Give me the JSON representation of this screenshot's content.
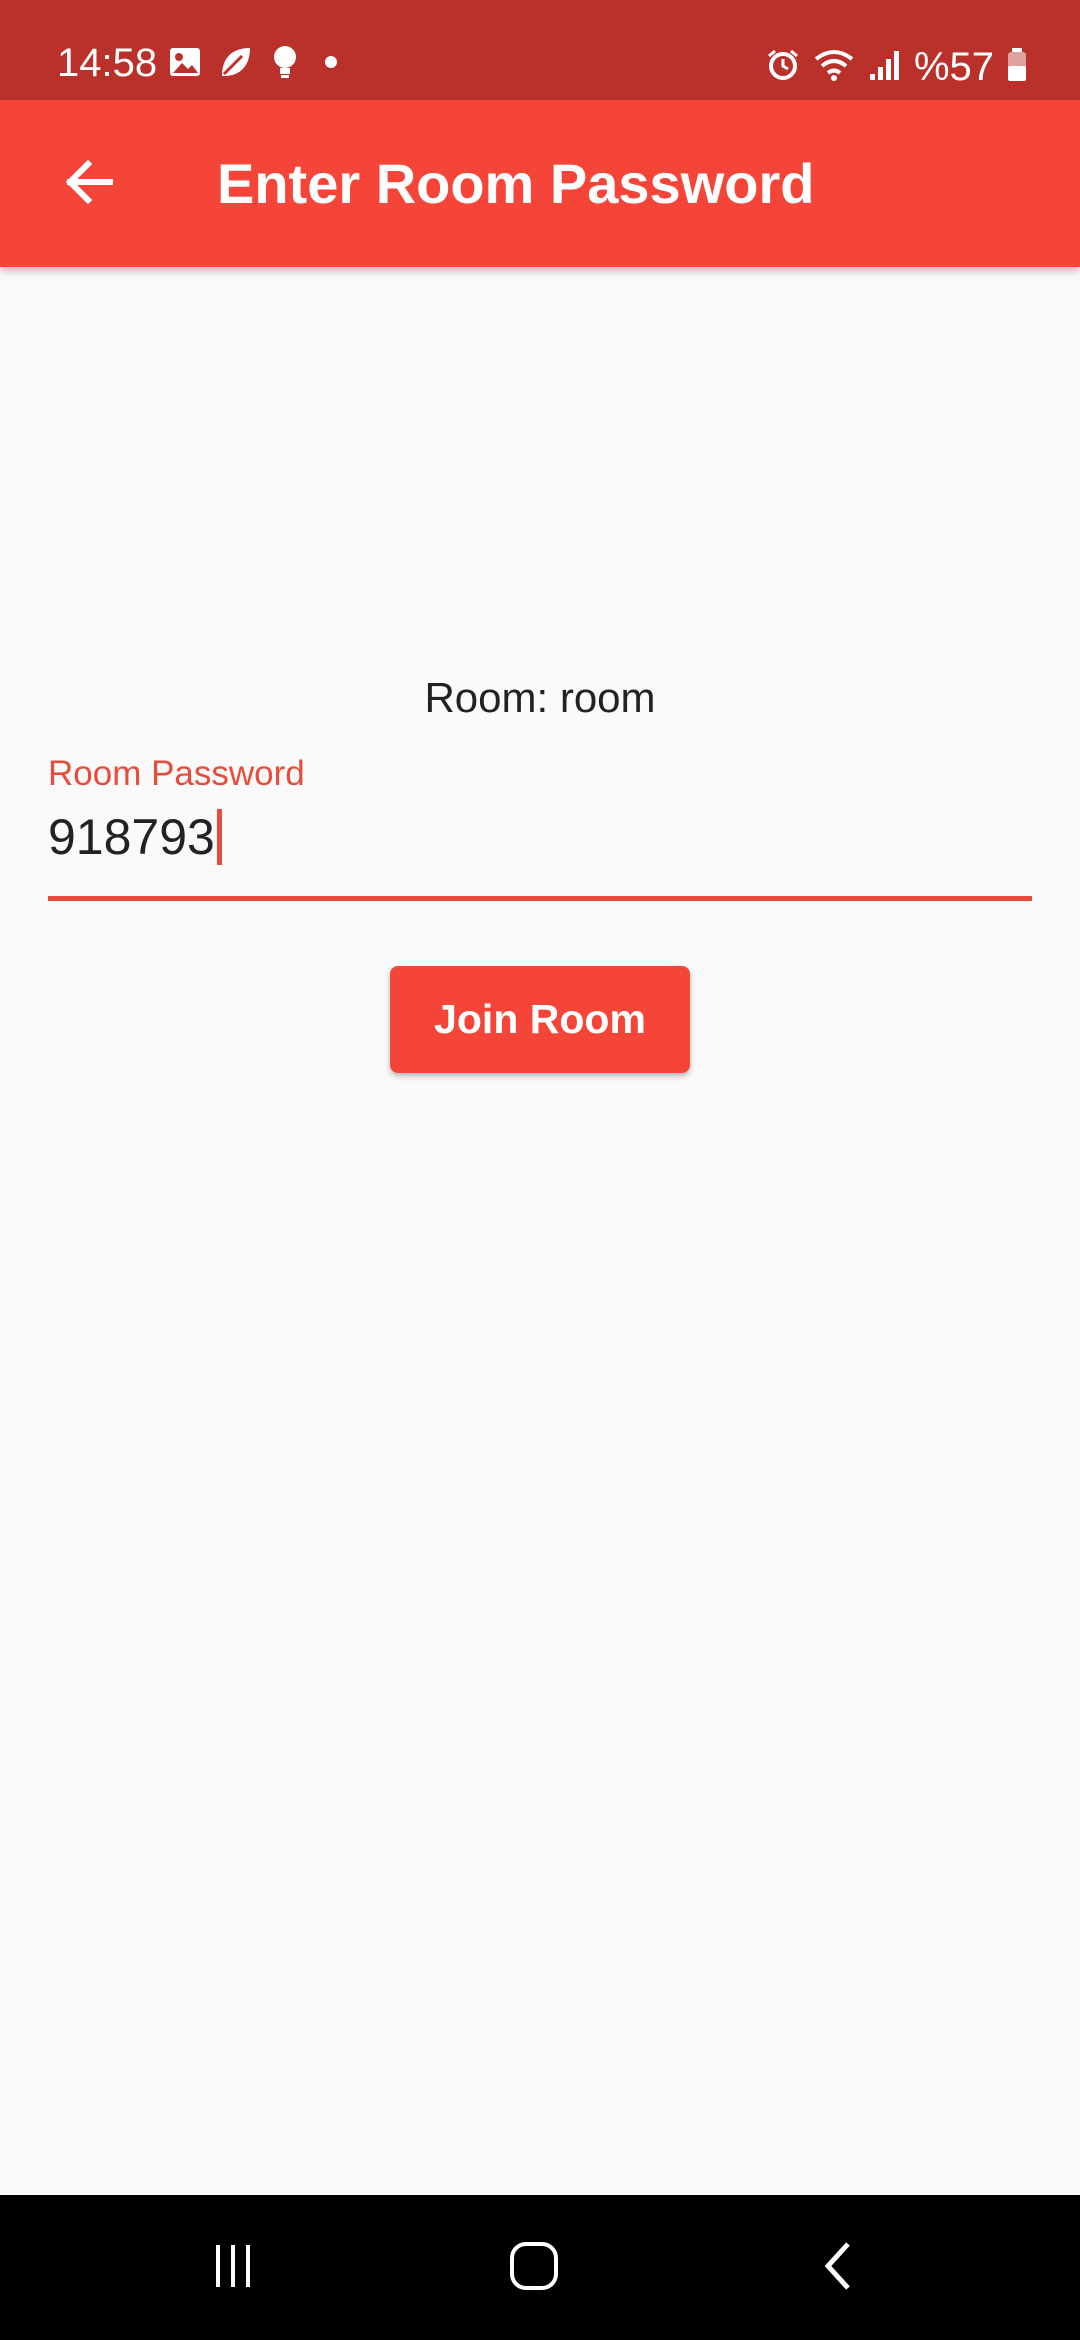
{
  "status_bar": {
    "time": "14:58",
    "battery": "%57",
    "left_icons": [
      "gallery-icon",
      "leaf-icon",
      "bulb-icon",
      "dot-icon"
    ],
    "right_icons": [
      "alarm-icon",
      "wifi-icon",
      "signal-icon",
      "battery-icon"
    ]
  },
  "app_bar": {
    "title": "Enter Room Password",
    "back_icon": "arrow-back-icon"
  },
  "main": {
    "room_text": "Room: room",
    "password_field": {
      "label": "Room Password",
      "value": "918793"
    },
    "join_button": "Join Room"
  },
  "nav_bar": {
    "icons": [
      "recent-apps-icon",
      "home-icon",
      "back-icon"
    ]
  },
  "colors": {
    "status_bar": "#b9312a",
    "app_bar": "#f44538",
    "accent": "#e74c3c",
    "background": "#fafafa"
  }
}
